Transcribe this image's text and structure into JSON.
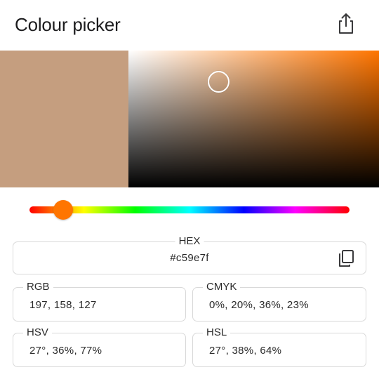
{
  "header": {
    "title": "Colour picker",
    "share_icon": "share-icon"
  },
  "color": {
    "selected": "#c59e7f",
    "hue_color": "#ff7500",
    "hue_degrees": 27,
    "saturation": 0.36,
    "value": 0.77
  },
  "hex": {
    "label": "HEX",
    "value": "#c59e7f",
    "copy_icon": "copy-icon"
  },
  "rgb": {
    "label": "RGB",
    "value": "197, 158, 127"
  },
  "cmyk": {
    "label": "CMYK",
    "value": "0%, 20%, 36%, 23%"
  },
  "hsv": {
    "label": "HSV",
    "value": "27°, 36%, 77%"
  },
  "hsl": {
    "label": "HSL",
    "value": "27°, 38%, 64%"
  }
}
